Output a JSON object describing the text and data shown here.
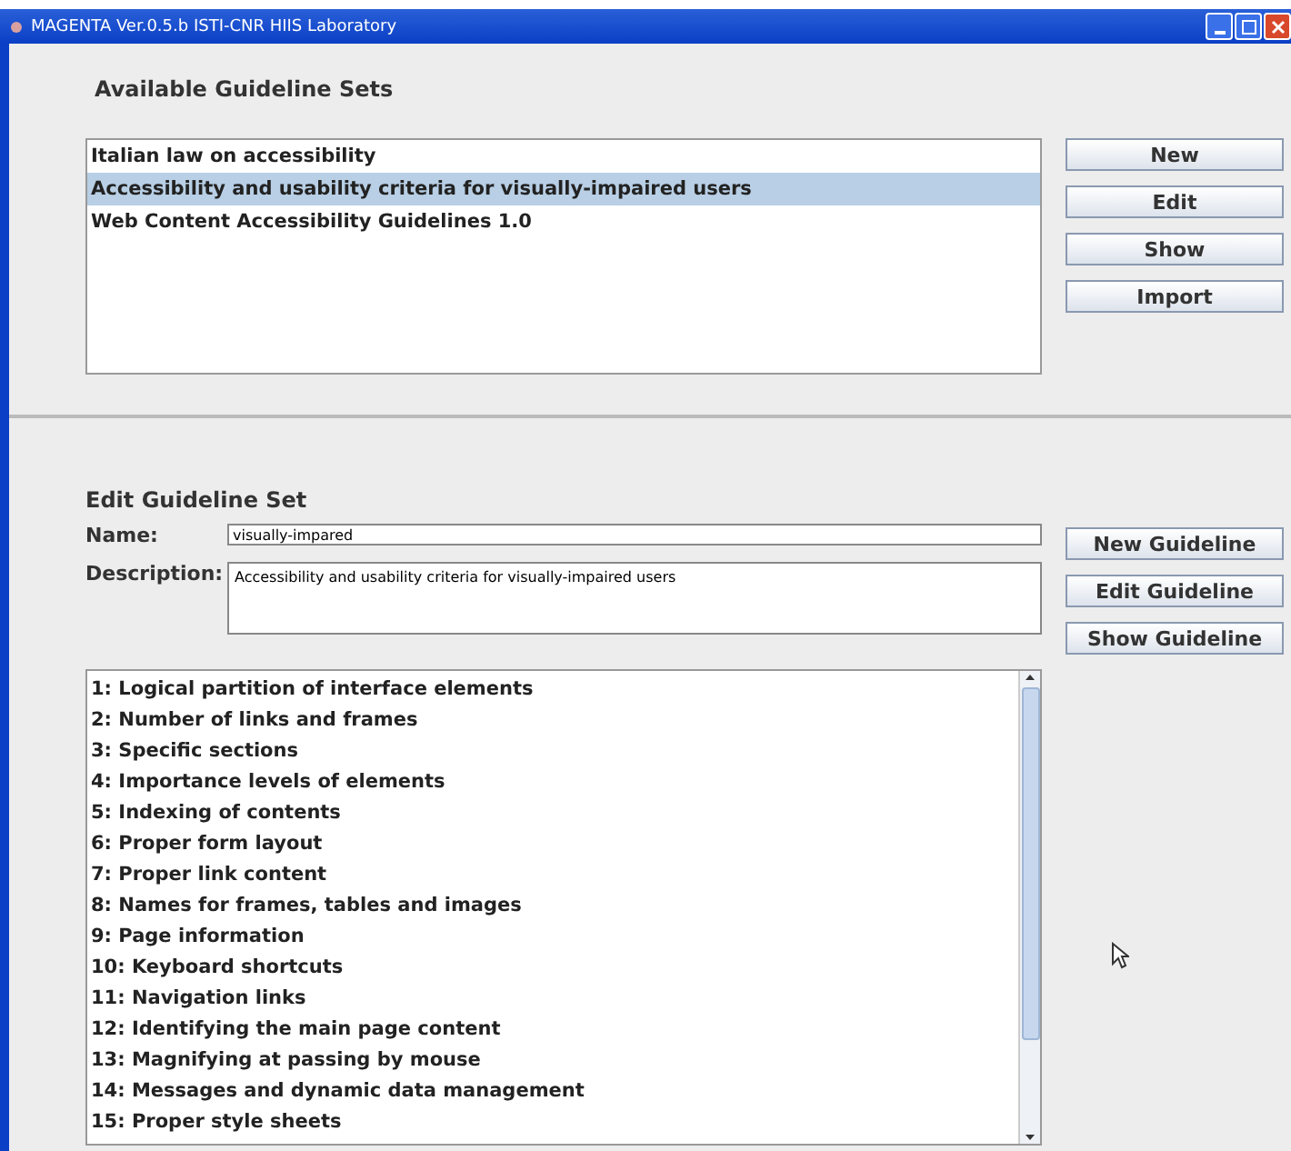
{
  "window": {
    "title": "MAGENTA Ver.0.5.b ISTI-CNR HIIS Laboratory"
  },
  "available": {
    "heading": "Available Guideline Sets",
    "items": [
      {
        "label": "Italian law on accessibility",
        "selected": false
      },
      {
        "label": "Accessibility and usability criteria for visually-impaired users",
        "selected": true
      },
      {
        "label": "Web Content Accessibility Guidelines 1.0",
        "selected": false
      }
    ],
    "buttons": [
      "New",
      "Edit",
      "Show",
      "Import"
    ]
  },
  "edit": {
    "heading": "Edit Guideline Set",
    "name_label": "Name:",
    "name_value": "visually-impared",
    "description_label": "Description:",
    "description_value": "Accessibility and usability criteria for visually-impaired users",
    "buttons": [
      "New Guideline",
      "Edit Guideline",
      "Show Guideline"
    ],
    "guidelines": [
      "1: Logical partition of interface elements",
      "2: Number of links and frames",
      "3: Specific sections",
      "4: Importance levels of elements",
      "5: Indexing of contents",
      "6: Proper form layout",
      "7: Proper link content",
      "8: Names for frames, tables and images",
      "9: Page information",
      "10: Keyboard shortcuts",
      "11: Navigation links",
      "12: Identifying the main page content",
      "13: Magnifying at passing by mouse",
      "14: Messages and dynamic data management",
      "15: Proper style sheets"
    ]
  }
}
